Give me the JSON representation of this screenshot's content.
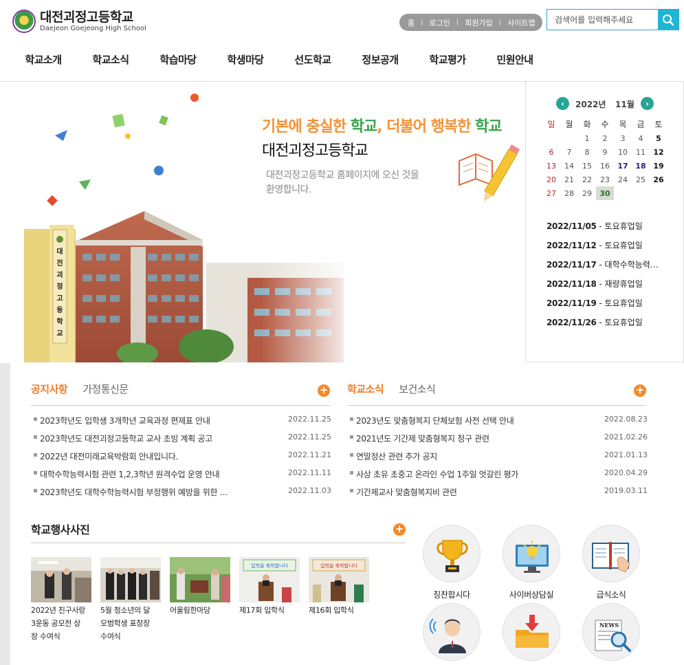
{
  "school": {
    "name_ko": "대전괴정고등학교",
    "name_en": "Daejeon Goejeong  High School"
  },
  "topmenu": [
    "홈",
    "로그인",
    "회원가입",
    "사이트맵"
  ],
  "search": {
    "placeholder": "검색어를 입력해주세요"
  },
  "gnb": [
    "학교소개",
    "학교소식",
    "학습마당",
    "학생마당",
    "선도학교",
    "정보공개",
    "학교평가",
    "민원안내"
  ],
  "visual": {
    "slogan_part1": "기본에 충실한 ",
    "slogan_part2": "학교",
    "slogan_part3": ", 더불어 행복한 ",
    "slogan_part4": "학교",
    "title": "대전괴정고등학교",
    "desc_line1": "대전괴정고등학교 홈페이지에 오신 것을",
    "desc_line2": "환영합니다.",
    "building_sign": "대전괴정고등학교"
  },
  "calendar": {
    "year": "2022년",
    "month": "11월",
    "weekdays": [
      "일",
      "월",
      "화",
      "수",
      "목",
      "금",
      "토"
    ],
    "weeks": [
      [
        "",
        "",
        "1",
        "2",
        "3",
        "4",
        "5"
      ],
      [
        "6",
        "7",
        "8",
        "9",
        "10",
        "11",
        "12"
      ],
      [
        "13",
        "14",
        "15",
        "16",
        "17",
        "18",
        "19"
      ],
      [
        "20",
        "21",
        "22",
        "23",
        "24",
        "25",
        "26"
      ],
      [
        "27",
        "28",
        "29",
        "30",
        "",
        "",
        ""
      ]
    ],
    "events": [
      {
        "date": "2022/11/05",
        "sep": " - ",
        "title": "토요휴업일"
      },
      {
        "date": "2022/11/12",
        "sep": " - ",
        "title": "토요휴업일"
      },
      {
        "date": "2022/11/17",
        "sep": " - ",
        "title": "대학수학능력…"
      },
      {
        "date": "2022/11/18",
        "sep": " - ",
        "title": "재량휴업일"
      },
      {
        "date": "2022/11/19",
        "sep": " - ",
        "title": "토요휴업일"
      },
      {
        "date": "2022/11/26",
        "sep": " - ",
        "title": "토요휴업일"
      }
    ]
  },
  "notice_board": {
    "tabs": [
      "공지사항",
      "가정통신문"
    ],
    "more": "+",
    "items": [
      {
        "title": "2023학년도 입학생 3개학년 교육과정 편제표 안내",
        "date": "2022.11.25"
      },
      {
        "title": "2023학년도 대전괴정고등학교 교사 초빙 계획 공고",
        "date": "2022.11.25"
      },
      {
        "title": "2022년 대전미래교육박람회 안내입니다.",
        "date": "2022.11.21"
      },
      {
        "title": "대학수학능력시험 관련 1,2,3학년 원격수업 운영 안내",
        "date": "2022.11.11"
      },
      {
        "title": "2023학년도 대학수학능력시험 부정행위 예방을 위한 …",
        "date": "2022.11.03"
      }
    ]
  },
  "news_board": {
    "tabs": [
      "학교소식",
      "보건소식"
    ],
    "more": "+",
    "items": [
      {
        "title": "2023년도 맞춤형복지 단체보험 사전 선택 안내",
        "date": "2022.08.23"
      },
      {
        "title": "2021년도 기간제 맞춤형복지 청구 관련",
        "date": "2021.02.26"
      },
      {
        "title": "연말정산 관련 추가 공지",
        "date": "2021.01.13"
      },
      {
        "title": "사상 초유 초중고 온라인 수업 1주일 엇갈린  평가",
        "date": "2020.04.29"
      },
      {
        "title": "기간제교사 맞춤형복지비 관련",
        "date": "2019.03.11"
      }
    ]
  },
  "photos": {
    "title": "학교행사사진",
    "more": "+",
    "items": [
      {
        "caption_lines": [
          "2022년 친구사랑",
          "3운동 공모전 상",
          "장 수여식"
        ]
      },
      {
        "caption_lines": [
          "5월 청소년의 달",
          "모범학생 표창장",
          "수여식"
        ]
      },
      {
        "caption_lines": [
          "어울림한마당"
        ]
      },
      {
        "caption_lines": [
          "제17회 입학식"
        ],
        "banner": "입학을 축하합니다"
      },
      {
        "caption_lines": [
          "제16회 입학식"
        ],
        "banner": "입학을 축하합니다"
      }
    ]
  },
  "quick": [
    {
      "label": "칭찬합시다",
      "icon": "trophy-icon"
    },
    {
      "label": "사이버상담실",
      "icon": "monitor-bulb-icon"
    },
    {
      "label": "급식소식",
      "icon": "book-hand-icon"
    },
    {
      "label": "",
      "icon": "person-icon"
    },
    {
      "label": "",
      "icon": "download-folder-icon"
    },
    {
      "label": "",
      "icon": "news-search-icon",
      "badge": "NEWS"
    }
  ],
  "colors": {
    "accent_orange": "#f07d2b",
    "calendar_green": "#28a497",
    "search_blue": "#1fb6d4"
  }
}
